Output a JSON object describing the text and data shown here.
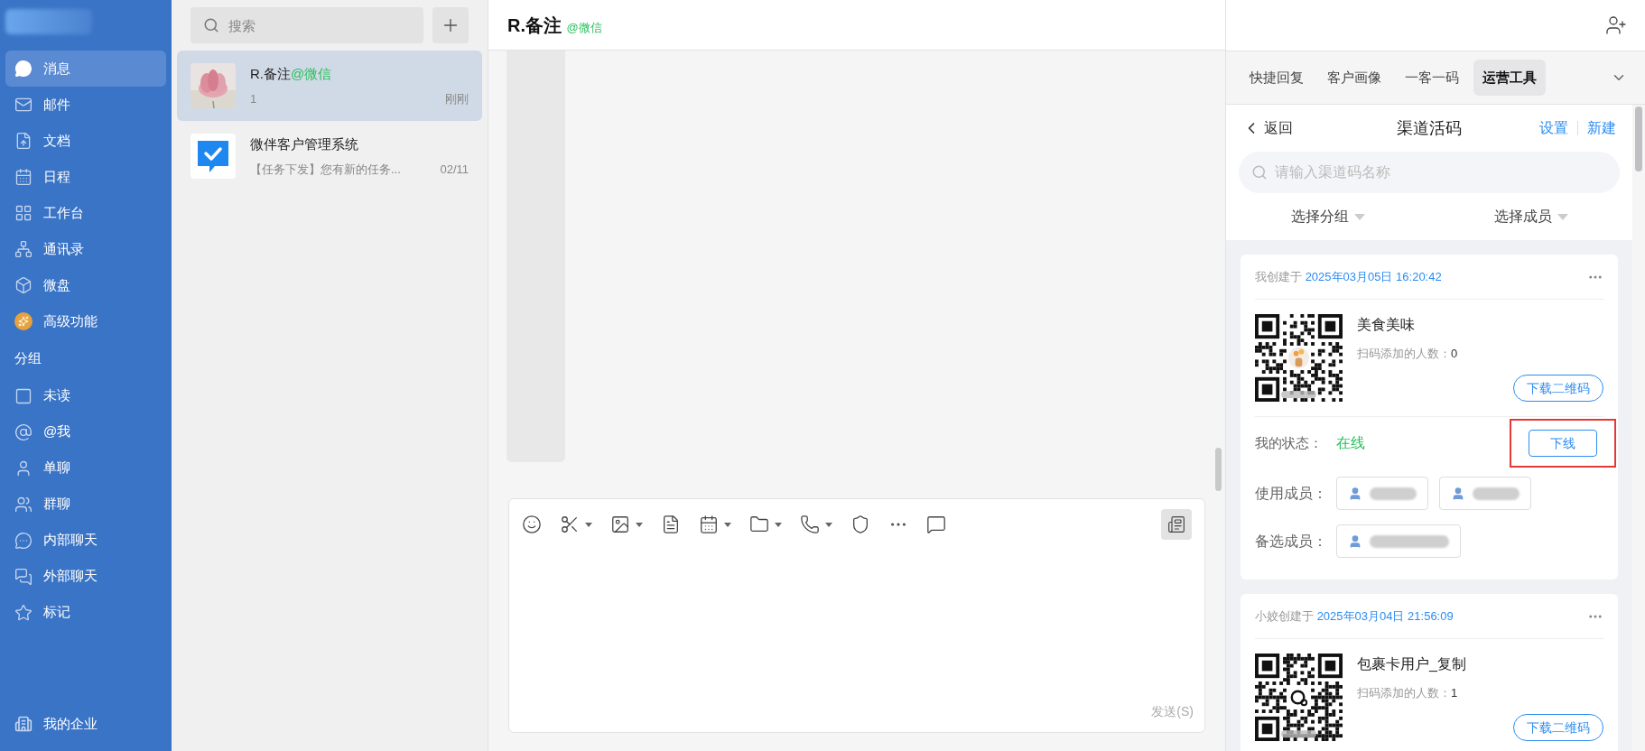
{
  "sidebar": {
    "items": [
      {
        "label": "消息",
        "selected": true
      },
      {
        "label": "邮件",
        "selected": false
      },
      {
        "label": "文档",
        "selected": false
      },
      {
        "label": "日程",
        "selected": false
      },
      {
        "label": "工作台",
        "selected": false
      },
      {
        "label": "通讯录",
        "selected": false
      },
      {
        "label": "微盘",
        "selected": false
      },
      {
        "label": "高级功能",
        "selected": false
      }
    ],
    "group_heading": "分组",
    "groups": [
      {
        "label": "未读",
        "selected": false
      },
      {
        "label": "@我",
        "selected": false
      },
      {
        "label": "单聊",
        "selected": false
      },
      {
        "label": "群聊",
        "selected": false
      },
      {
        "label": "内部聊天",
        "selected": false
      },
      {
        "label": "外部聊天",
        "selected": false
      },
      {
        "label": "标记",
        "selected": false
      }
    ],
    "footer": "我的企业"
  },
  "chat_list": {
    "search": {
      "placeholder": "搜索"
    },
    "chats": [
      {
        "name": "R.备注",
        "source": "@微信",
        "preview": "1",
        "time": "刚刚",
        "selected": true
      },
      {
        "kind": "app",
        "name": "微伴客户管理系统",
        "preview": "【任务下发】您有新的任务...",
        "time": "02/11",
        "selected": false
      }
    ]
  },
  "chat": {
    "title": "R.备注",
    "source": "@微信",
    "send_button": "发送(S)"
  },
  "right_panel": {
    "tabs": [
      {
        "label": "快捷回复",
        "selected": false
      },
      {
        "label": "客户画像",
        "selected": false
      },
      {
        "label": "一客一码",
        "selected": false
      },
      {
        "label": "运营工具",
        "selected": true
      }
    ],
    "back": "返回",
    "title": "渠道活码",
    "settings": "设置",
    "new": "新建",
    "search": {
      "placeholder": "请输入渠道码名称"
    },
    "filters": [
      "选择分组",
      "选择成员"
    ],
    "cards": [
      {
        "kind": "vase_qr",
        "creator": "我创建于",
        "created_at": "2025年03月05日 16:20:42",
        "name": "美食美味",
        "scan_label": "扫码添加的人数：",
        "scan_count": "0",
        "download": "下载二维码",
        "status": {
          "label": "我的状态：",
          "value": "在线",
          "online": true,
          "action": "下线",
          "highlighted": true
        },
        "member_groups": [
          {
            "label": "使用成员：",
            "members": [
              {
                "kind": "blurred"
              },
              {
                "kind": "blurred"
              }
            ]
          },
          {
            "label": "备选成员：",
            "members": [
              {
                "kind": "blurred"
              }
            ]
          }
        ]
      },
      {
        "kind": "chat_qr",
        "creator": "小姣创建于",
        "created_at": "2025年03月04日 21:56:09",
        "name": "包裹卡用户_复制",
        "scan_label": "扫码添加的人数：",
        "scan_count": "1",
        "download": "下载二维码"
      }
    ]
  }
}
